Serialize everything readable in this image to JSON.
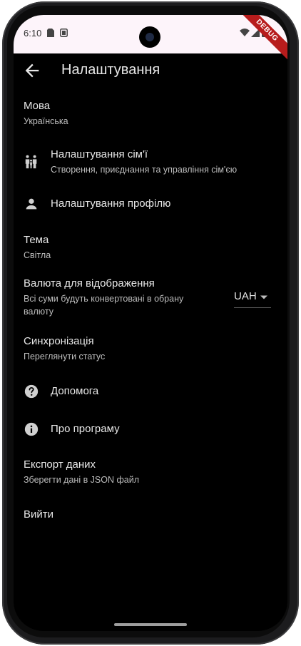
{
  "status_bar": {
    "time": "6:10",
    "debug_label": "DEBUG"
  },
  "app_bar": {
    "title": "Налаштування",
    "back_icon": "arrow-back-icon"
  },
  "settings": {
    "language": {
      "title": "Мова",
      "subtitle": "Українська"
    },
    "family": {
      "title": "Налаштування сім'ї",
      "subtitle": "Створення, приєднання та управління сім'єю",
      "icon": "family-icon"
    },
    "profile": {
      "title": "Налаштування профілю",
      "icon": "person-icon"
    },
    "theme": {
      "title": "Тема",
      "subtitle": "Світла"
    },
    "currency": {
      "title": "Валюта для відображення",
      "subtitle_line1": "Всі суми будуть конвертовані в обрану",
      "subtitle_line2": "валюту",
      "selected": "UAH"
    },
    "sync": {
      "title": "Синхронізація",
      "subtitle": "Переглянути статус"
    },
    "help": {
      "title": "Допомога",
      "icon": "help-icon"
    },
    "about": {
      "title": "Про програму",
      "icon": "info-icon"
    },
    "export": {
      "title": "Експорт даних",
      "subtitle": "Зберегти дані в JSON файл"
    },
    "logout": {
      "title": "Вийти"
    }
  },
  "colors": {
    "background": "#000000",
    "status_bar": "#fdf4fa",
    "primary_text": "#e8e8e8",
    "secondary_text": "#bdbdbd",
    "debug_ribbon": "#b71c1c"
  }
}
